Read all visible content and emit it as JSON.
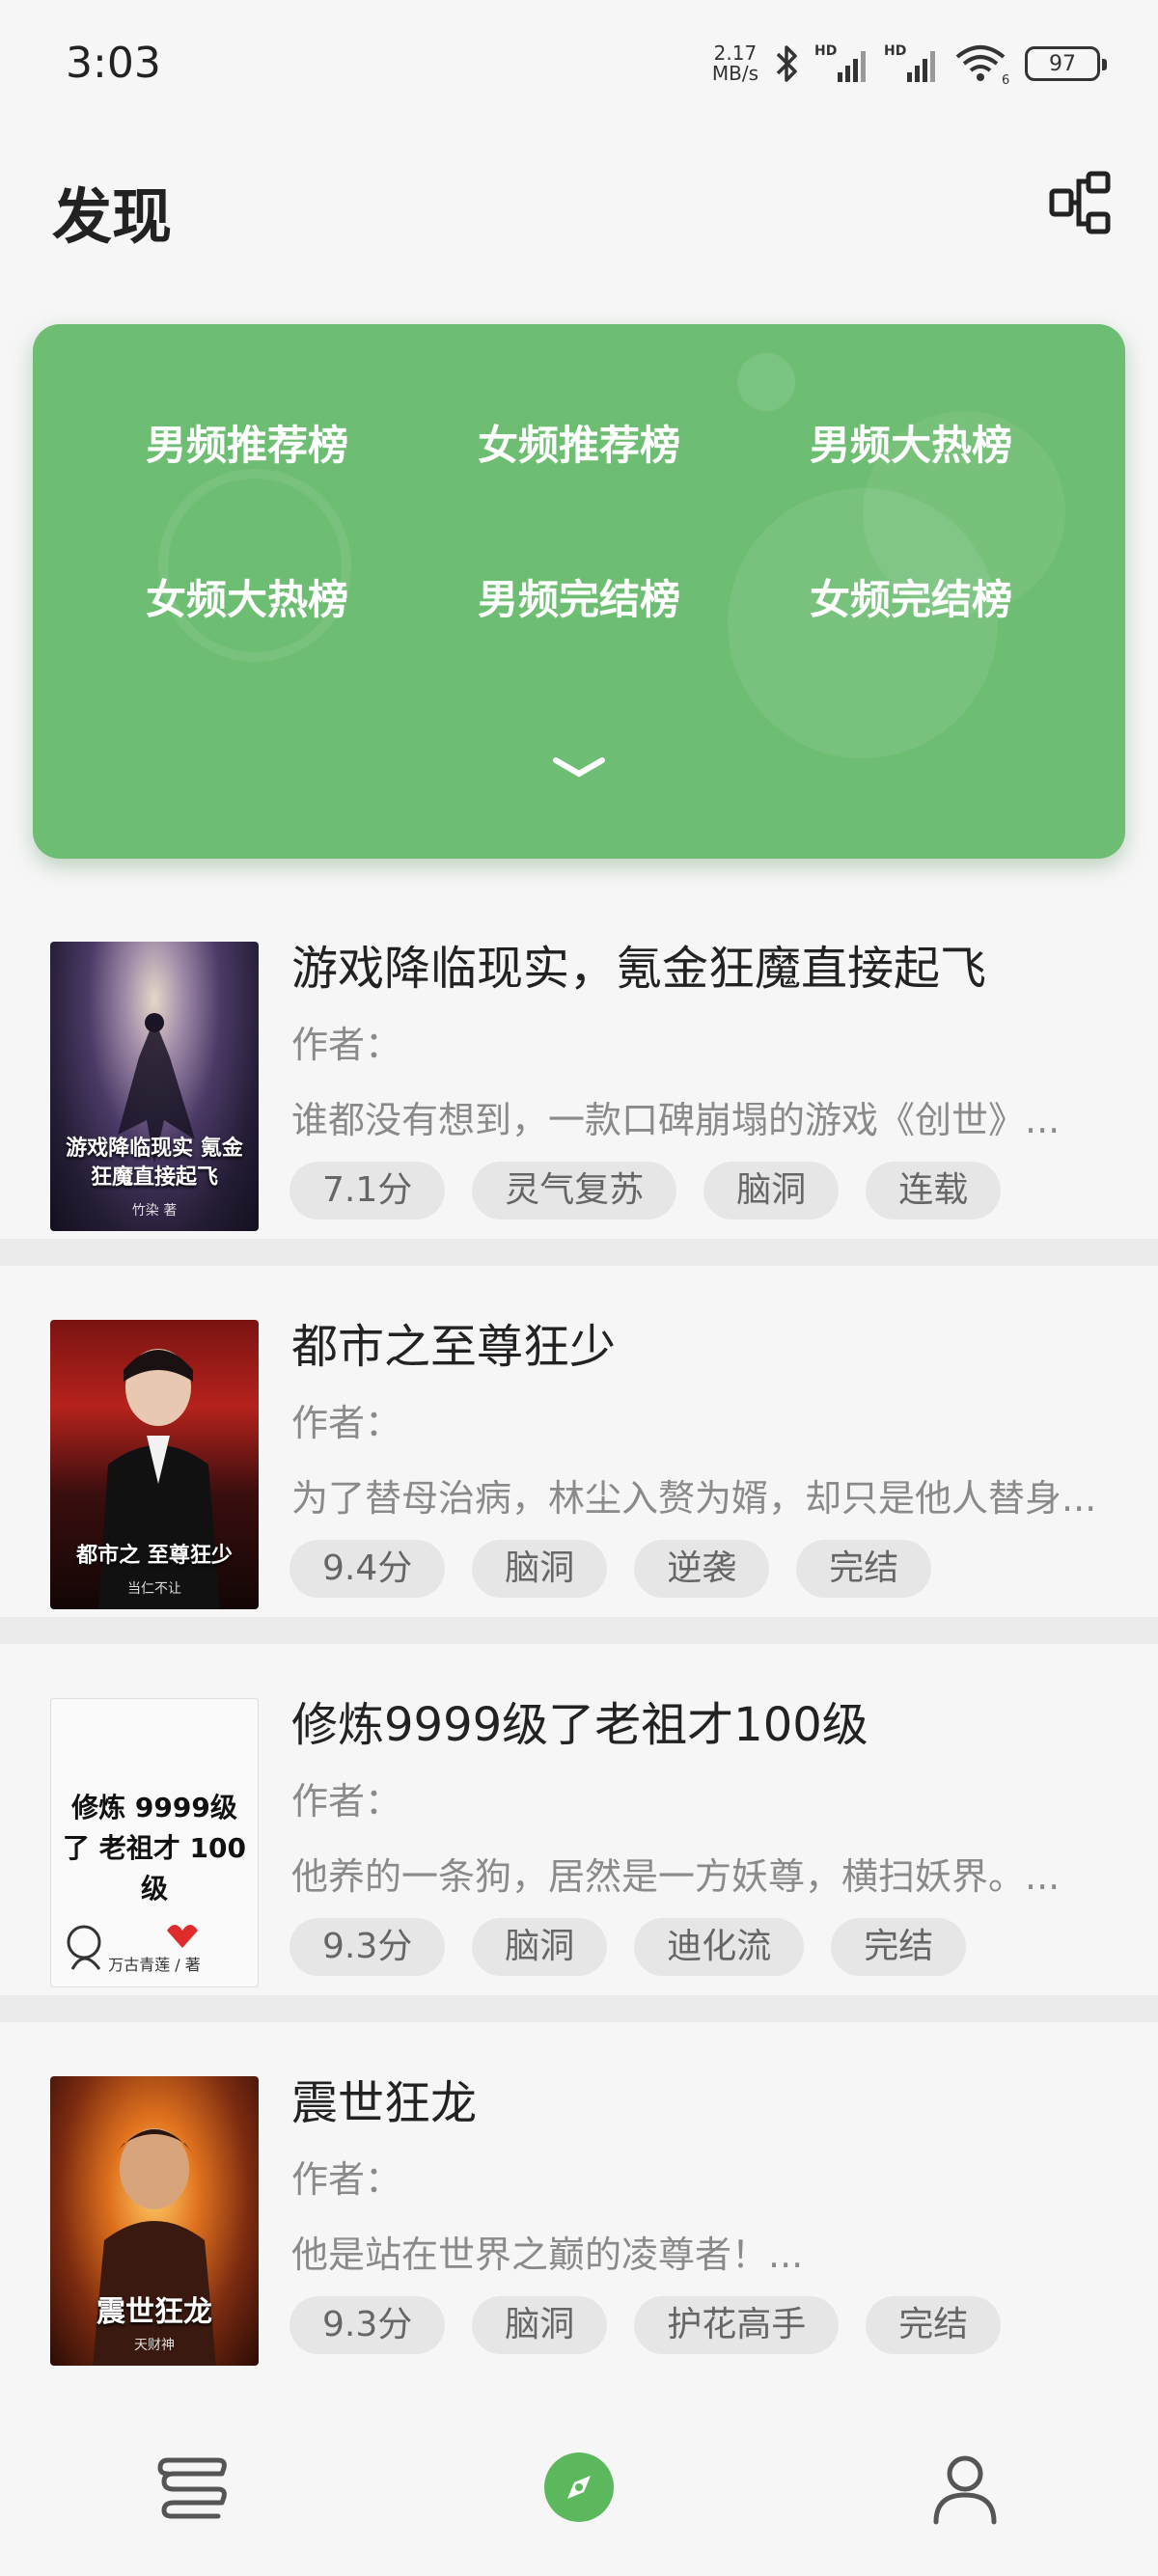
{
  "status_bar": {
    "time": "3:03",
    "net_speed_value": "2.17",
    "net_speed_unit": "MB/s",
    "battery": "97"
  },
  "header": {
    "title": "发现"
  },
  "rankings": {
    "items": [
      "男频推荐榜",
      "女频推荐榜",
      "男频大热榜",
      "女频大热榜",
      "男频完结榜",
      "女频完结榜"
    ],
    "accent_color": "#6dbd72"
  },
  "books": [
    {
      "title": "游戏降临现实，氪金狂魔直接起飞",
      "author": "作者：",
      "description": "谁都没有想到，一款口碑崩塌的游戏《创世》...",
      "tags": [
        "7.1分",
        "灵气复苏",
        "脑洞",
        "连载"
      ],
      "cover_title": "游戏降临现实 氪金狂魔直接起飞",
      "cover_sub": "竹染 著"
    },
    {
      "title": "都市之至尊狂少",
      "author": "作者：",
      "description": "为了替母治病，林尘入赘为婿，却只是他人替身...",
      "tags": [
        "9.4分",
        "脑洞",
        "逆袭",
        "完结"
      ],
      "cover_title": "都市之 至尊狂少",
      "cover_sub": "当仁不让"
    },
    {
      "title": "修炼9999级了老祖才100级",
      "author": "作者：",
      "description": "他养的一条狗，居然是一方妖尊，横扫妖界。...",
      "tags": [
        "9.3分",
        "脑洞",
        "迪化流",
        "完结"
      ],
      "cover_title": "修炼 9999级了 老祖才 100级",
      "cover_sub": "万古青莲 / 著"
    },
    {
      "title": "震世狂龙",
      "author": "作者：",
      "description": "他是站在世界之巅的凌尊者！...",
      "tags": [
        "9.3分",
        "脑洞",
        "护花高手",
        "完结"
      ],
      "cover_title": "震世狂龙",
      "cover_sub": "天财神"
    }
  ],
  "bottom_nav": {
    "items": [
      "bookshelf-icon",
      "discover-compass-icon",
      "profile-icon"
    ],
    "active_color": "#5cb85c"
  }
}
